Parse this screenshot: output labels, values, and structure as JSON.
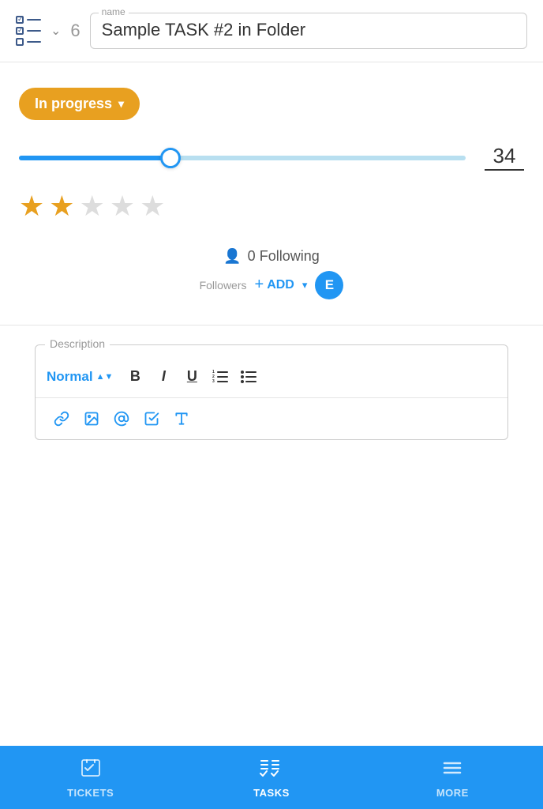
{
  "header": {
    "task_number": "6",
    "name_label": "name",
    "task_name": "Sample TASK #2 in Folder"
  },
  "status": {
    "label": "In progress",
    "chevron": "▾"
  },
  "progress": {
    "value": "34",
    "fill_percent": 34
  },
  "stars": {
    "filled": 2,
    "total": 5
  },
  "followers": {
    "count": "0",
    "following_label": "Following",
    "followers_label": "Followers",
    "add_label": "ADD",
    "avatar_letter": "E"
  },
  "description": {
    "legend": "Description",
    "style_label": "Normal",
    "toolbar": {
      "bold": "B",
      "italic": "I",
      "underline": "U"
    }
  },
  "bottom_nav": {
    "items": [
      {
        "id": "tickets",
        "label": "TICKETS",
        "active": false
      },
      {
        "id": "tasks",
        "label": "TASKS",
        "active": true
      },
      {
        "id": "more",
        "label": "MORE",
        "active": false
      }
    ]
  }
}
